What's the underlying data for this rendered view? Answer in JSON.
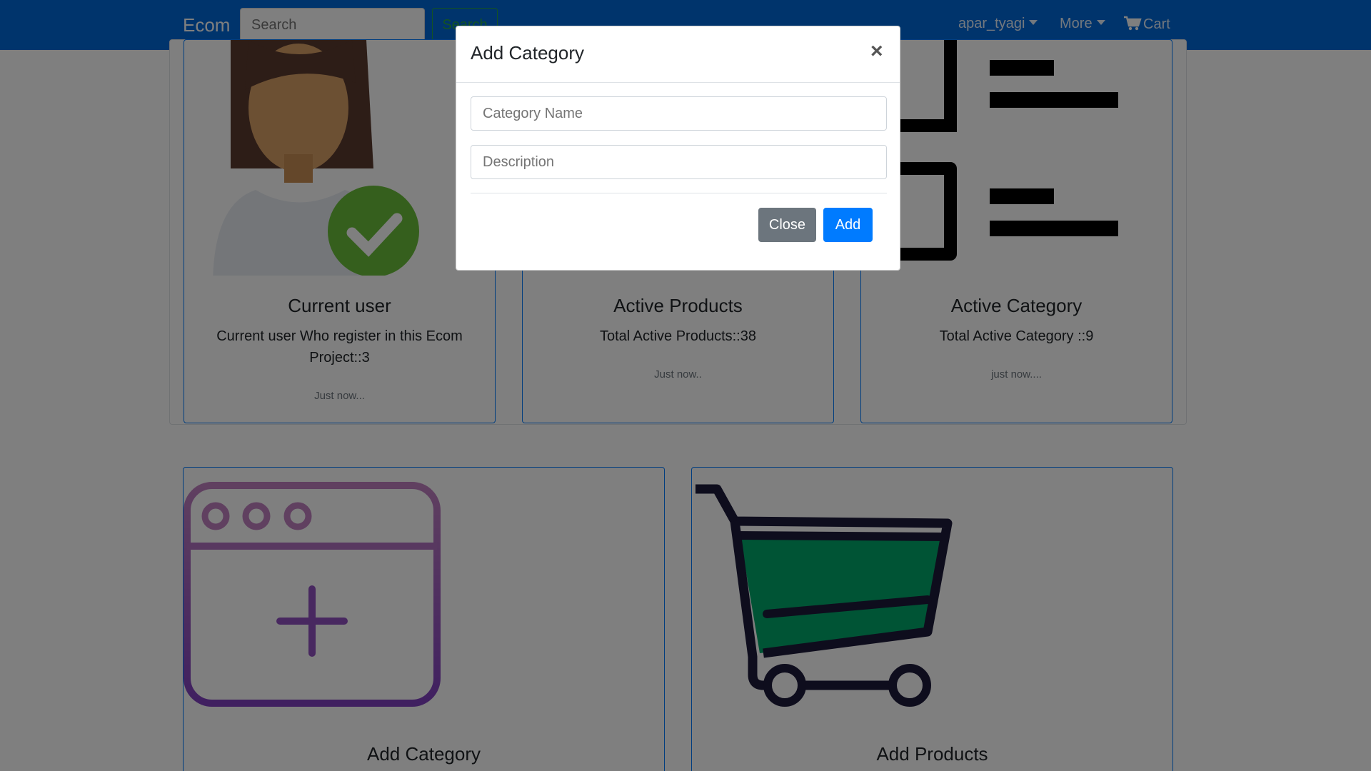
{
  "navbar": {
    "brand": "Ecom",
    "search_placeholder": "Search",
    "search_button": "Search",
    "user_menu": "apar_tyagi",
    "more_menu": "More",
    "cart": "Cart"
  },
  "cards": [
    {
      "title": "Current user",
      "text": "Current user Who register in this Ecom Project::3",
      "footer": "Just now..."
    },
    {
      "title": "Active Products",
      "text": "Total Active Products::38",
      "footer": "Just now.."
    },
    {
      "title": "Active Category",
      "text": "Total Active Category ::9",
      "footer": "just now...."
    }
  ],
  "actions": [
    {
      "title": "Add Category"
    },
    {
      "title": "Add Products"
    }
  ],
  "modal": {
    "title": "Add Category",
    "close_symbol": "×",
    "category_name_placeholder": "Category Name",
    "description_placeholder": "Description",
    "close_button": "Close",
    "add_button": "Add"
  },
  "colors": {
    "navbar": "#0069d9",
    "primary": "#007bff",
    "secondary": "#6c757d",
    "success": "#28a745",
    "cart_fill": "#00a86b",
    "cart_outline": "#1d1a3a",
    "window_icon_top": "#c080c0",
    "window_icon_bottom": "#8040c0"
  }
}
